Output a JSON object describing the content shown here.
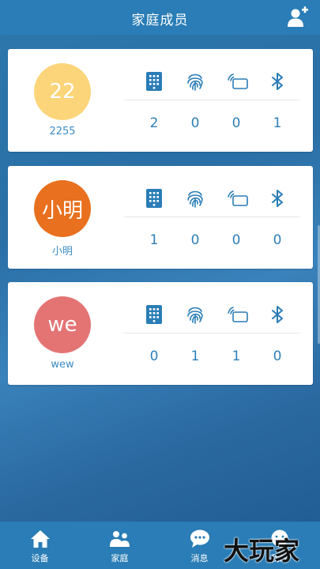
{
  "header": {
    "title": "家庭成员",
    "add_user_icon": "add-user-icon"
  },
  "members": [
    {
      "avatar_text": "22",
      "avatar_color": "#fcd57a",
      "name": "2255",
      "counts": [
        "2",
        "0",
        "0",
        "1"
      ]
    },
    {
      "avatar_text": "小明",
      "avatar_color": "#e8701e",
      "name": "小明",
      "counts": [
        "1",
        "0",
        "0",
        "0"
      ]
    },
    {
      "avatar_text": "we",
      "avatar_color": "#e47474",
      "name": "wew",
      "counts": [
        "0",
        "1",
        "1",
        "0"
      ]
    }
  ],
  "unlock_icons": [
    "keypad-icon",
    "fingerprint-icon",
    "card-icon",
    "bluetooth-icon"
  ],
  "tabbar": {
    "tabs": [
      {
        "label": "设备",
        "icon": "home-icon"
      },
      {
        "label": "家庭",
        "icon": "family-icon"
      },
      {
        "label": "消息",
        "icon": "message-icon"
      },
      {
        "label": "我的",
        "icon": "profile-icon"
      }
    ]
  },
  "watermark": "大玩家",
  "colors": {
    "accent": "#2d7fb8",
    "header_bg": "#2a7db6",
    "icon_blue": "#2a7db6"
  }
}
